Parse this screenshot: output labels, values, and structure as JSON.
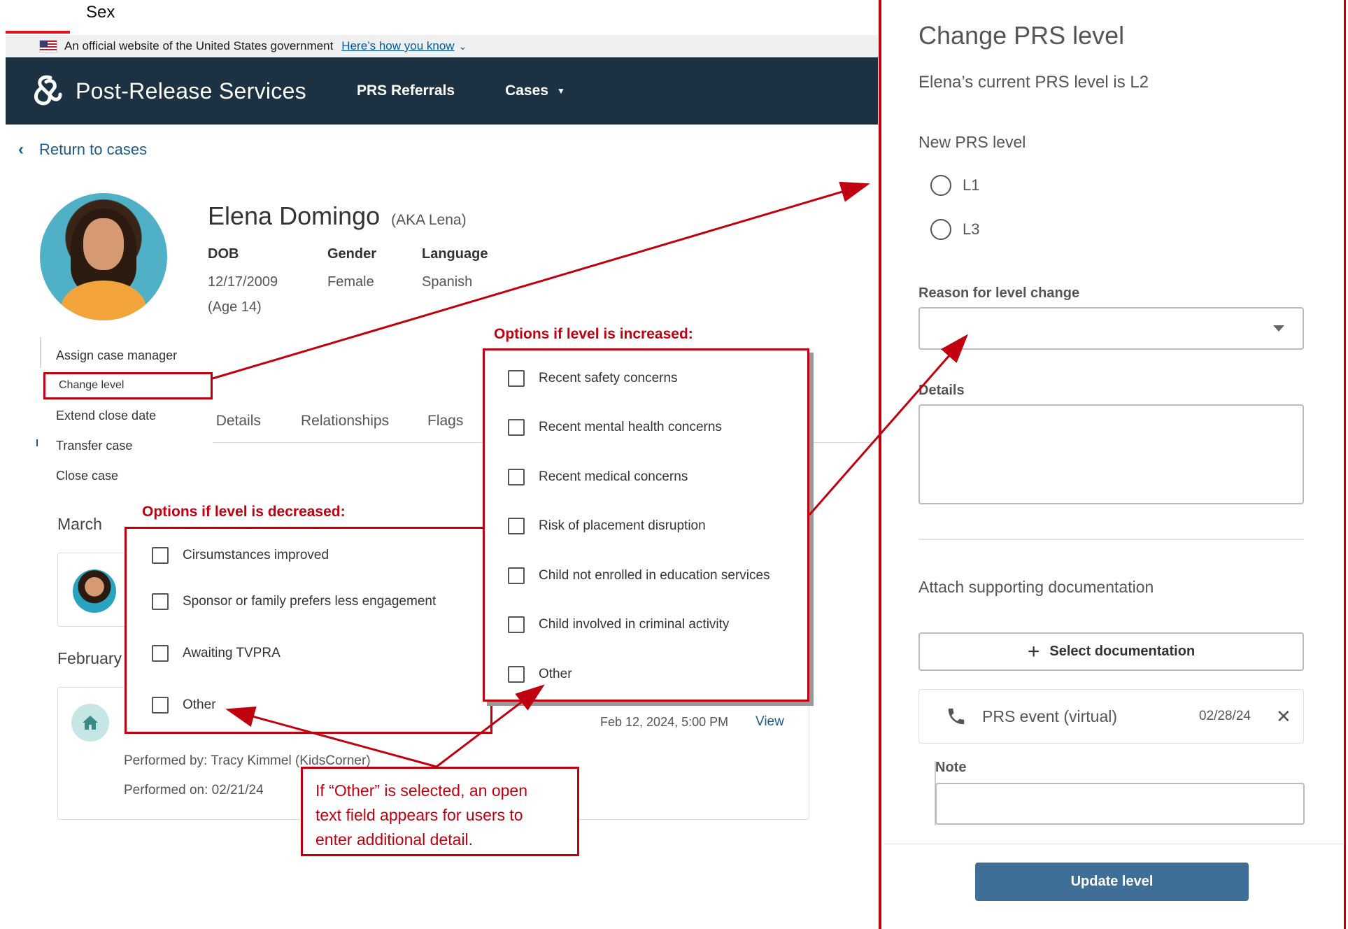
{
  "top_label": "Sex",
  "gov_banner": {
    "text": "An official website of the United States government",
    "link": "Here’s how you know"
  },
  "header": {
    "app_title": "Post-Release Services",
    "nav": [
      "PRS Referrals",
      "Cases"
    ]
  },
  "back_link": "Return to cases",
  "profile": {
    "name": "Elena Domingo",
    "aka": "(AKA Lena)",
    "dob_label": "DOB",
    "dob": "12/17/2009",
    "age": "(Age 14)",
    "gender_label": "Gender",
    "gender": "Female",
    "language_label": "Language",
    "language": "Spanish"
  },
  "action_menu": [
    "Assign case manager",
    "Change level",
    "Extend close date",
    "Transfer case",
    "Close case"
  ],
  "tabs": [
    "Details",
    "Relationships",
    "Flags"
  ],
  "tab_partial": ":",
  "timeline": {
    "month1": "March",
    "month2": "February",
    "entry_timestamp": "Feb 12, 2024, 5:00 PM",
    "view": "View",
    "performed_by": "Performed by: Tracy Kimmel (KidsCorner)",
    "performed_on": "Performed on: 02/21/24"
  },
  "annotations": {
    "decreased_title": "Options if level is decreased:",
    "decreased_options": [
      "Cirsumstances improved",
      "Sponsor or family prefers less engagement",
      "Awaiting TVPRA",
      "Other"
    ],
    "increased_title": "Options if level is increased:",
    "increased_options": [
      "Recent safety concerns",
      "Recent mental health concerns",
      "Recent medical concerns",
      "Risk of placement disruption",
      "Child not enrolled in education services",
      "Child involved in criminal activity",
      "Other"
    ],
    "other_note": [
      "If “Other” is selected, an open",
      "text field appears for users to",
      "enter additional detail."
    ]
  },
  "panel": {
    "title": "Change PRS level",
    "subtitle": "Elena’s current PRS level is L2",
    "new_level_label": "New PRS level",
    "levels": [
      "L1",
      "L3"
    ],
    "reason_label": "Reason for level change",
    "details_label": "Details",
    "attach_label": "Attach supporting documentation",
    "select_doc": "Select documentation",
    "doc_name": "PRS event (virtual)",
    "doc_date": "02/28/24",
    "note_label": "Note",
    "update_button": "Update level"
  },
  "colors": {
    "header_bg": "#1c3243",
    "annotation_red": "#c0000f",
    "link_blue": "#005ea2",
    "primary_button": "#3f6f96"
  }
}
